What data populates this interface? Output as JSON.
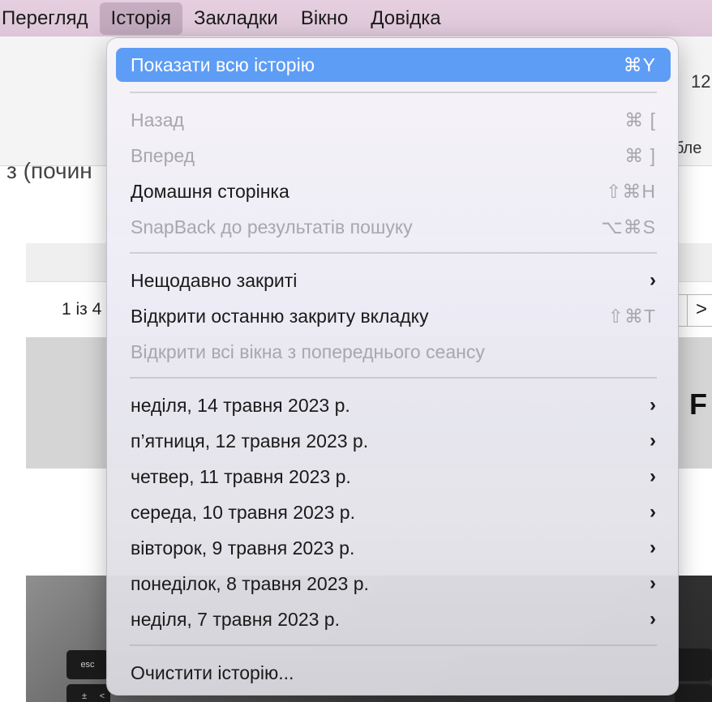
{
  "menubar": {
    "items": [
      "Перегляд",
      "Історія",
      "Закладки",
      "Вікно",
      "Довідка"
    ]
  },
  "background": {
    "toolbar_number": "12",
    "toolbar_text": "бле",
    "page_heading": "з (почин",
    "pager_text": "1 із 4",
    "pager_next": ">",
    "grey_block_letter": "F",
    "keyboard_keys": [
      "esc",
      "±",
      "<"
    ]
  },
  "history_menu": {
    "show_all": {
      "label": "Показати всю історію",
      "shortcut": "⌘Y"
    },
    "back": {
      "label": "Назад",
      "shortcut": "⌘ ["
    },
    "forward": {
      "label": "Вперед",
      "shortcut": "⌘ ]"
    },
    "home": {
      "label": "Домашня сторінка",
      "shortcut": "⇧⌘H"
    },
    "snapback": {
      "label": "SnapBack до результатів пошуку",
      "shortcut": "⌥⌘S"
    },
    "recently_closed": {
      "label": "Нещодавно закриті",
      "arrow": "›"
    },
    "reopen_last_tab": {
      "label": "Відкрити останню закриту вкладку",
      "shortcut": "⇧⌘T"
    },
    "reopen_all_windows": {
      "label": "Відкрити всі вікна з попереднього сеансу"
    },
    "days": [
      {
        "label": "неділя, 14 травня 2023 р.",
        "arrow": "›"
      },
      {
        "label": "п’ятниця, 12 травня 2023 р.",
        "arrow": "›"
      },
      {
        "label": "четвер, 11 травня 2023 р.",
        "arrow": "›"
      },
      {
        "label": "середа, 10 травня 2023 р.",
        "arrow": "›"
      },
      {
        "label": "вівторок, 9 травня 2023 р.",
        "arrow": "›"
      },
      {
        "label": "понеділок, 8 травня 2023 р.",
        "arrow": "›"
      },
      {
        "label": "неділя, 7 травня 2023 р.",
        "arrow": "›"
      }
    ],
    "clear_history": {
      "label": "Очистити історію..."
    }
  },
  "colors": {
    "menubar": "#dcc6d8",
    "highlight": "#5e9df5",
    "disabled_text": "#a7a7ad"
  }
}
